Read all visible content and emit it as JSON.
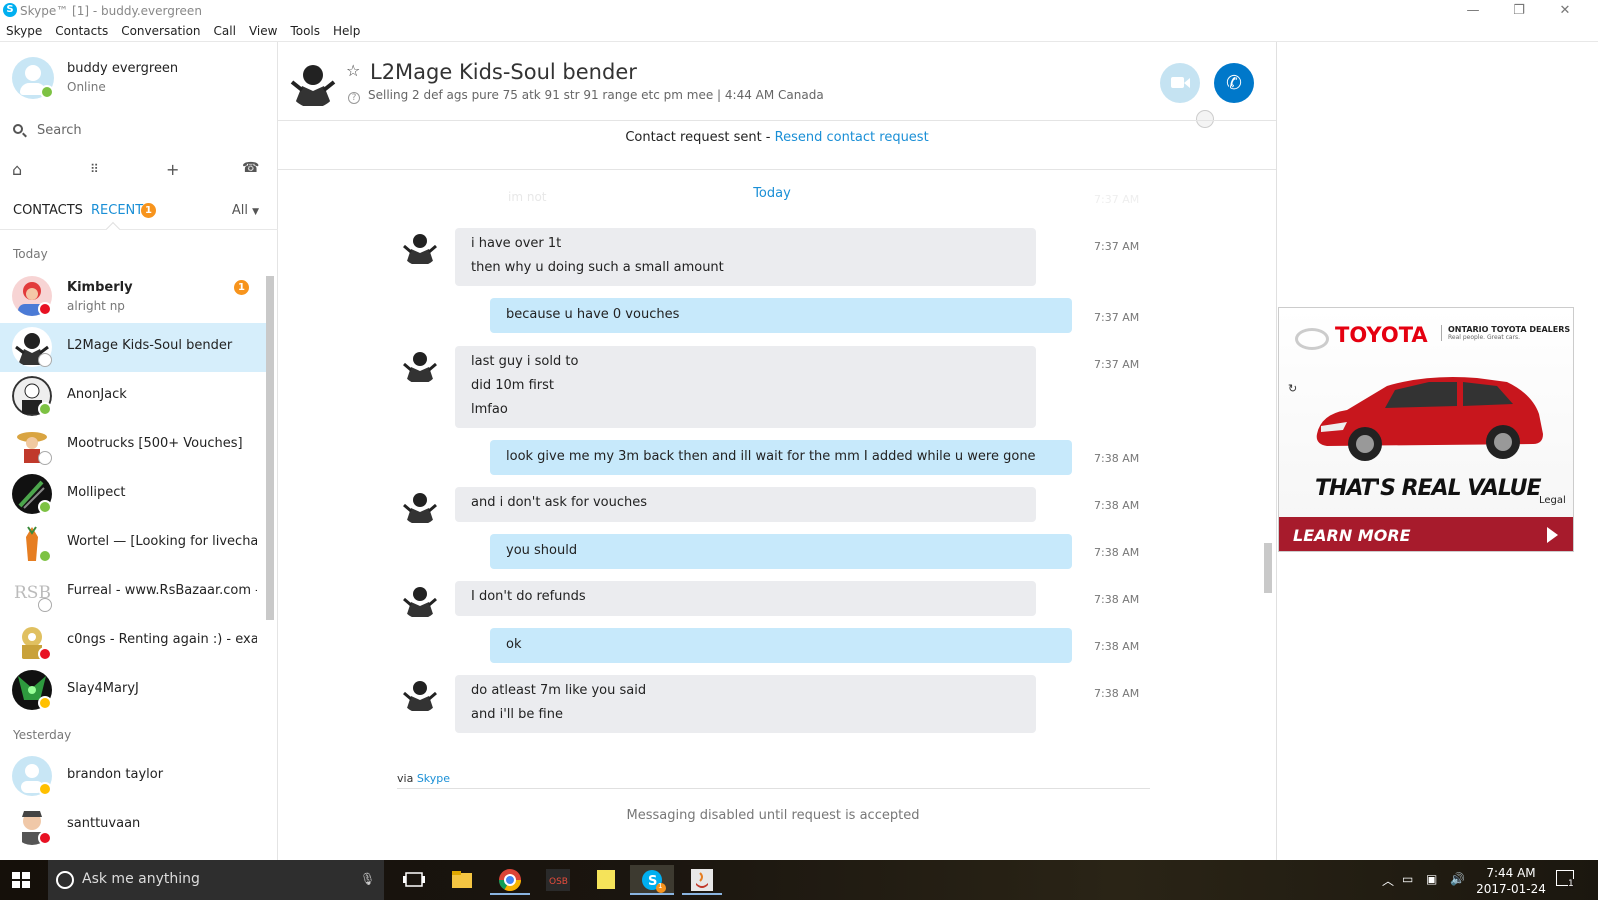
{
  "window": {
    "title": "Skype™ [1] - buddy.evergreen",
    "controls": {
      "minimize": "—",
      "restore": "❐",
      "close": "✕"
    }
  },
  "menu": [
    "Skype",
    "Contacts",
    "Conversation",
    "Call",
    "View",
    "Tools",
    "Help"
  ],
  "me": {
    "name": "buddy evergreen",
    "status": "Online"
  },
  "search": {
    "label": "Search"
  },
  "tabs": {
    "contacts": "CONTACTS",
    "recent": "RECENT",
    "recent_badge": "1",
    "filter": "All"
  },
  "sections": {
    "today": "Today",
    "yesterday": "Yesterday"
  },
  "contacts": [
    {
      "name": "Kimberly",
      "sub": "alright np",
      "badge": "1",
      "status": "busy"
    },
    {
      "name": "L2Mage Kids-Soul bender",
      "status": "unknown",
      "selected": true
    },
    {
      "name": "AnonJack",
      "status": "online"
    },
    {
      "name": "Mootrucks [500+ Vouches]",
      "status": "unknown"
    },
    {
      "name": "Mollipect",
      "status": "online"
    },
    {
      "name": "Wortel — [Looking for livecha...",
      "status": "online"
    },
    {
      "name": "Furreal - www.RsBazaar.com -...",
      "status": "unknown"
    },
    {
      "name": "c0ngs - Renting again :) - exa...",
      "status": "busy"
    },
    {
      "name": "Slay4MaryJ",
      "status": "away"
    },
    {
      "name": "brandon taylor",
      "status": "away"
    },
    {
      "name": "santtuvaan",
      "status": "busy"
    }
  ],
  "conversation": {
    "name": "L2Mage Kids-Soul bender",
    "mood": "Selling 2 def ags pure 75 atk 91 str 91 range etc pm mee",
    "local_time": "4:44 AM Canada",
    "request_text": "Contact request sent - ",
    "request_link": "Resend contact request",
    "day_label": "Today",
    "ghost_text": "im not",
    "ghost_time": "7:37 AM",
    "messages": [
      {
        "dir": "in",
        "lines": [
          "i have over 1t",
          "then why u doing such a small amount"
        ],
        "time": "7:37 AM"
      },
      {
        "dir": "out",
        "lines": [
          "because u have 0 vouches"
        ],
        "time": "7:37 AM"
      },
      {
        "dir": "in",
        "lines": [
          "last guy i sold to",
          "did 10m first",
          "lmfao"
        ],
        "time": "7:37 AM"
      },
      {
        "dir": "out",
        "lines": [
          "look give me my 3m back then and ill wait for the mm I added while u were gone"
        ],
        "time": "7:38 AM"
      },
      {
        "dir": "in",
        "lines": [
          "and i don't ask for vouches"
        ],
        "time": "7:38 AM"
      },
      {
        "dir": "out",
        "lines": [
          "you should"
        ],
        "time": "7:38 AM"
      },
      {
        "dir": "in",
        "lines": [
          "I don't do refunds"
        ],
        "time": "7:38 AM"
      },
      {
        "dir": "out",
        "lines": [
          "ok"
        ],
        "time": "7:38 AM"
      },
      {
        "dir": "in",
        "lines": [
          "do atleast 7m like you said",
          "and i'll be fine"
        ],
        "time": "7:38 AM"
      }
    ],
    "via": "via ",
    "via_link": "Skype",
    "disabled_notice": "Messaging disabled until request is accepted"
  },
  "ad": {
    "brand": "TOYOTA",
    "dealers": "ONTARIO TOYOTA DEALERS",
    "tagline": "Real people. Great cars.",
    "slogan": "THAT'S REAL VALUE",
    "legal": "Legal",
    "cta": "LEARN MORE",
    "car_color": "#c8161d"
  },
  "taskbar": {
    "search_placeholder": "Ask me anything",
    "time": "7:44 AM",
    "date": "2017-01-24",
    "skype_badge": "1",
    "notifications": "1"
  },
  "colors": {
    "accent": "#1a8fd6",
    "selected": "#d6eefb",
    "bubble_in": "#ebecef",
    "bubble_out": "#c7e9fb",
    "call": "#0078ca"
  }
}
